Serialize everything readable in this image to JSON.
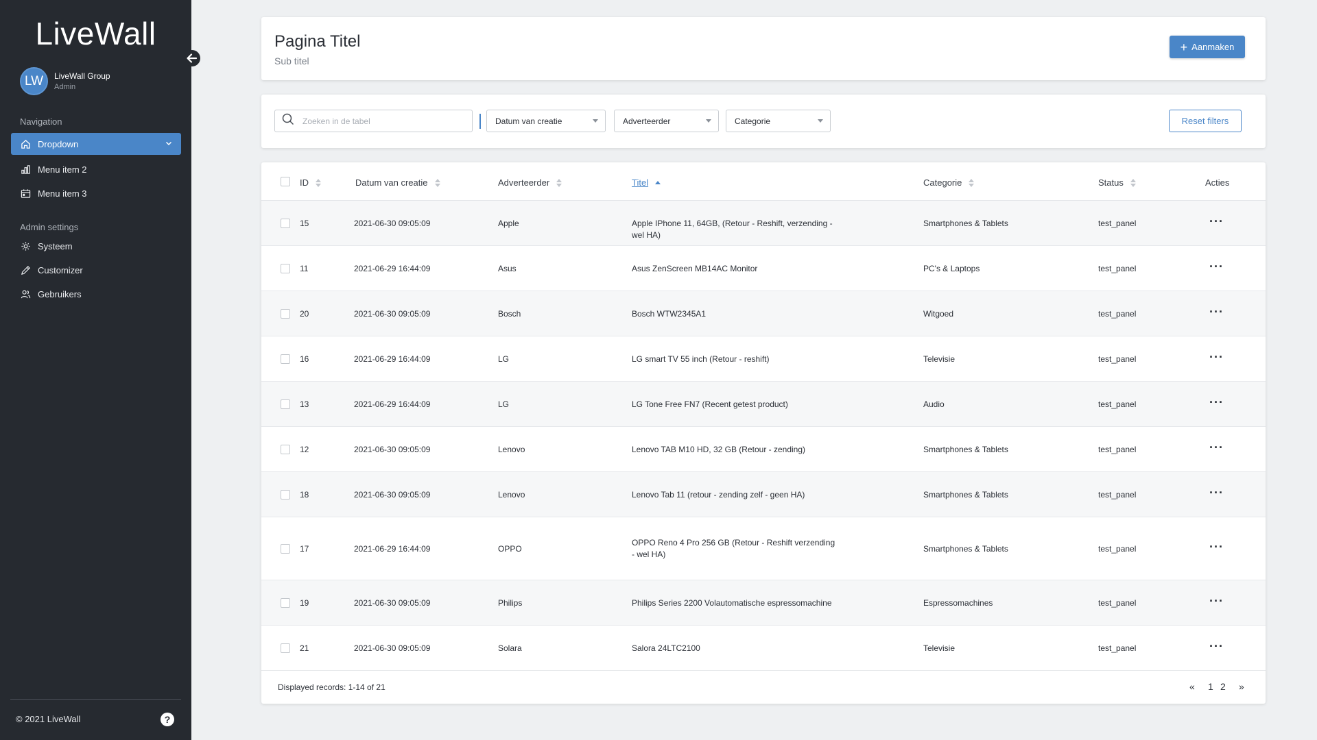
{
  "sidebar": {
    "logo": "LiveWall",
    "user": {
      "initials": "LW",
      "name": "LiveWall Group",
      "role": "Admin"
    },
    "nav_label": "Navigation",
    "nav_items": [
      {
        "label": "Dropdown",
        "icon": "home-icon"
      },
      {
        "label": "Menu item 2",
        "icon": "bar-chart-icon"
      },
      {
        "label": "Menu item 3",
        "icon": "calendar-icon"
      }
    ],
    "admin_label": "Admin settings",
    "admin_items": [
      {
        "label": "Systeem",
        "icon": "gear-icon"
      },
      {
        "label": "Customizer",
        "icon": "pencil-icon"
      },
      {
        "label": "Gebruikers",
        "icon": "users-icon"
      }
    ],
    "copyright": "© 2021 LiveWall"
  },
  "header": {
    "title": "Pagina Titel",
    "subtitle": "Sub titel",
    "create_label": "Aanmaken"
  },
  "filters": {
    "search_placeholder": "Zoeken in de tabel",
    "date": "Datum van creatie",
    "advertiser": "Adverteerder",
    "category": "Categorie",
    "reset_label": "Reset filters"
  },
  "table": {
    "columns": {
      "id": "ID",
      "date": "Datum van creatie",
      "advertiser": "Adverteerder",
      "title": "Titel",
      "category": "Categorie",
      "status": "Status",
      "actions": "Acties"
    },
    "rows": [
      {
        "id": "15",
        "date": "2021-06-30 09:05:09",
        "advertiser": "Apple",
        "title": "Apple IPhone 11, 64GB, (Retour - Reshift, verzending - wel HA)",
        "category": "Smartphones & Tablets",
        "status": "test_panel"
      },
      {
        "id": "11",
        "date": "2021-06-29 16:44:09",
        "advertiser": "Asus",
        "title": "Asus ZenScreen MB14AC Monitor",
        "category": "PC's & Laptops",
        "status": "test_panel"
      },
      {
        "id": "20",
        "date": "2021-06-30 09:05:09",
        "advertiser": "Bosch",
        "title": "Bosch WTW2345A1",
        "category": "Witgoed",
        "status": "test_panel"
      },
      {
        "id": "16",
        "date": "2021-06-29 16:44:09",
        "advertiser": "LG",
        "title": "LG  smart TV 55 inch (Retour - reshift)",
        "category": "Televisie",
        "status": "test_panel"
      },
      {
        "id": "13",
        "date": "2021-06-29 16:44:09",
        "advertiser": "LG",
        "title": "LG Tone Free FN7 (Recent getest product)",
        "category": "Audio",
        "status": "test_panel"
      },
      {
        "id": "12",
        "date": "2021-06-30 09:05:09",
        "advertiser": "Lenovo",
        "title": "Lenovo TAB M10 HD, 32 GB (Retour - zending)",
        "category": "Smartphones & Tablets",
        "status": "test_panel"
      },
      {
        "id": "18",
        "date": "2021-06-30 09:05:09",
        "advertiser": "Lenovo",
        "title": "Lenovo Tab 11 (retour - zending zelf - geen HA)",
        "category": "Smartphones & Tablets",
        "status": "test_panel"
      },
      {
        "id": "17",
        "date": "2021-06-29 16:44:09",
        "advertiser": "OPPO",
        "title": "OPPO Reno 4 Pro 256 GB (Retour - Reshift verzending - wel HA)",
        "category": "Smartphones & Tablets",
        "status": "test_panel"
      },
      {
        "id": "19",
        "date": "2021-06-30 09:05:09",
        "advertiser": "Philips",
        "title": "Philips Series 2200 Volautomatische espressomachine",
        "category": "Espressomachines",
        "status": "test_panel"
      },
      {
        "id": "21",
        "date": "2021-06-30 09:05:09",
        "advertiser": "Solara",
        "title": "Salora 24LTC2100",
        "category": "Televisie",
        "status": "test_panel"
      }
    ],
    "footer": "Displayed records: 1-14 of 21",
    "pagination": {
      "prev": "«",
      "pages": [
        "1",
        "2"
      ],
      "next": "»"
    }
  },
  "colors": {
    "accent": "#4a86c8",
    "sidebar_bg": "#262a30",
    "page_bg": "#eef0f2"
  }
}
